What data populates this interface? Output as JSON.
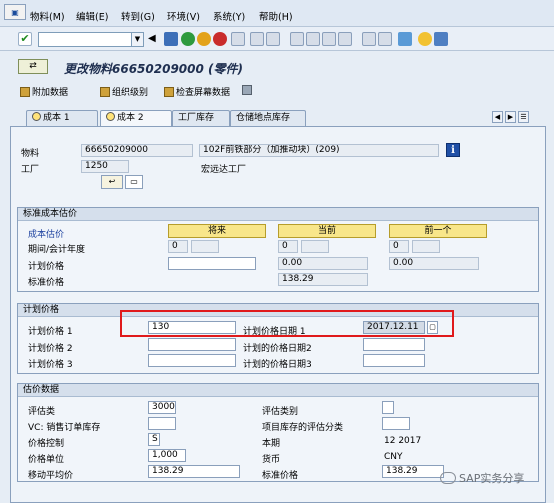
{
  "menu": {
    "items": [
      "物料(M)",
      "编辑(E)",
      "转到(G)",
      "环境(V)",
      "系统(Y)",
      "帮助(H)"
    ]
  },
  "title": "更改物料66650209000 (零件)",
  "app_toolbar": {
    "additional_data": "附加数据",
    "org_levels": "组织级别",
    "check_screen_data": "检查屏幕数据"
  },
  "tabs": [
    "成本 1",
    "成本 2",
    "工厂库存",
    "仓储地点库存"
  ],
  "header": {
    "material_label": "物料",
    "material_value": "66650209000",
    "material_desc": "102F前铁部分（加推动块）(209)",
    "plant_label": "工厂",
    "plant_value": "1250",
    "plant_name": "宏远达工厂"
  },
  "std_cost_estimate": {
    "title": "标准成本估价",
    "cost_estimate_label": "成本估价",
    "col_future": "将来",
    "col_current": "当前",
    "col_previous": "前一个",
    "period_fy_label": "期间/会计年度",
    "future_period": "0",
    "current_period": "0",
    "previous_period": "0",
    "planned_price_label": "计划价格",
    "current_planned": "0.00",
    "previous_planned": "0.00",
    "standard_price_label": "标准价格",
    "current_standard": "138.29"
  },
  "planned_prices": {
    "title": "计划价格",
    "price1_label": "计划价格 1",
    "price1_value": "130",
    "price2_label": "计划价格 2",
    "price3_label": "计划价格 3",
    "date1_label": "计划价格日期 1",
    "date1_value": "2017.12.11",
    "date2_label": "计划的价格日期2",
    "date3_label": "计划的价格日期3"
  },
  "valuation": {
    "title": "估价数据",
    "val_class_label": "评估类",
    "val_class_value": "3000",
    "val_category_label": "评估类别",
    "vc_label": "VC: 销售订单库存",
    "proj_stock_label": "项目库存的评估分类",
    "price_control_label": "价格控制",
    "price_control_value": "S",
    "current_period_label": "本期",
    "current_period_value": "12 2017",
    "price_unit_label": "价格单位",
    "price_unit_value": "1,000",
    "currency_label": "货币",
    "currency_value": "CNY",
    "mov_avg_label": "移动平均价",
    "mov_avg_value": "138.29",
    "std_price_label": "标准价格",
    "std_price_value": "138.29"
  },
  "watermark": "SAP实务分享",
  "colors": {
    "highlight_box": "#e0191b",
    "header_band": "#d5dfec",
    "button_yellow": "#f8e68a",
    "info_blue": "#1f4fa6"
  }
}
